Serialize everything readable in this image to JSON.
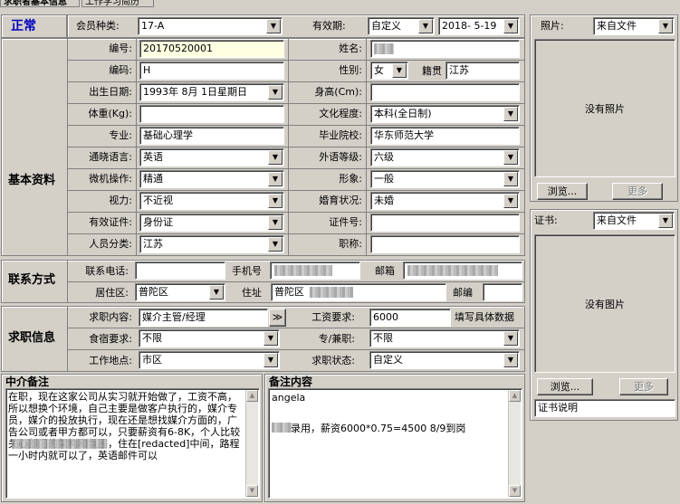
{
  "tabs": [
    "求职者基本信息",
    "工作学习简历"
  ],
  "status": "正常",
  "sections": {
    "basic": "基本资料",
    "contact": "联系方式",
    "job": "求职信息",
    "agent_note": "中介备注",
    "note": "备注内容"
  },
  "header": {
    "member_type_label": "会员种类:",
    "member_type_value": "17-A",
    "validity_label": "有效期:",
    "validity_mode": "自定义",
    "validity_date": "2018- 5-19"
  },
  "labels": {
    "id": "编号:",
    "name": "姓名:",
    "code": "编码:",
    "gender": "性别:",
    "native": "籍贯",
    "birth": "出生日期:",
    "height": "身高(Cm):",
    "weight": "体重(Kg):",
    "education": "文化程度:",
    "major": "专业:",
    "school": "毕业院校:",
    "language": "通晓语言:",
    "foreign_level": "外语等级:",
    "computer": "微机操作:",
    "appearance": "形象:",
    "vision": "视力:",
    "marriage": "婚育状况:",
    "id_type": "有效证件:",
    "id_no": "证件号:",
    "category": "人员分类:",
    "title": "职称:",
    "phone": "联系电话:",
    "mobile": "手机号",
    "email": "邮箱",
    "district": "居住区:",
    "address": "住址",
    "postcode": "邮编",
    "job_content": "求职内容:",
    "salary": "工资要求:",
    "salary_hint": "填写具体数据",
    "board": "食宿要求:",
    "fulltime": "专/兼职:",
    "location": "工作地点:",
    "job_status": "求职状态:"
  },
  "values": {
    "id": "20170520001",
    "code": "H",
    "gender": "女",
    "native": "江苏",
    "birth": "1993年 8月 1日星期日",
    "education": "本科(全日制)",
    "major": "基础心理学",
    "school": "华东师范大学",
    "language": "英语",
    "foreign_level": "六级",
    "computer": "精通",
    "appearance": "一般",
    "vision": "不近视",
    "marriage": "未婚",
    "id_type": "身份证",
    "category": "江苏",
    "district": "普陀区",
    "address": "普陀区",
    "job_content": "媒介主管/经理",
    "job_more": "≫",
    "salary": "6000",
    "board": "不限",
    "fulltime": "不限",
    "location": "市区",
    "job_status": "自定义"
  },
  "photo": {
    "label": "照片:",
    "source": "来自文件",
    "empty": "没有照片",
    "browse": "浏览...",
    "more": "更多"
  },
  "cert": {
    "label": "证书:",
    "source": "来自文件",
    "empty": "没有图片",
    "browse": "浏览...",
    "more": "更多",
    "desc": "证书说明"
  },
  "agent_note_text": "在职，现在这家公司从实习就开始做了，工资不高，所以想换个环境，自己主要是做客户执行的，媒介专员，媒介的投放执行，现在还是想找媒介方面的，广告公司或者甲方都可以，只要薪资有6-8K，个人比较关心部门的架构和氛围，住在[redacted]中间，路程一小时内就可以了，英语邮件可以",
  "note_lines": [
    "angela",
    "",
    "录用，薪资6000*0.75=4500 8/9到岗"
  ]
}
